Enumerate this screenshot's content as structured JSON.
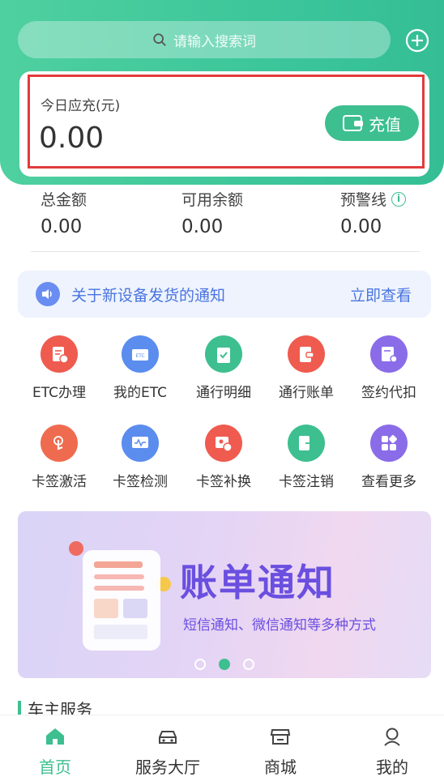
{
  "search": {
    "placeholder": "请输入搜索词"
  },
  "recharge_card": {
    "label": "今日应充(元)",
    "amount": "0.00",
    "button_label": "充值"
  },
  "stats": [
    {
      "label": "总金额",
      "value": "0.00"
    },
    {
      "label": "可用余额",
      "value": "0.00"
    },
    {
      "label": "预警线",
      "value": "0.00"
    }
  ],
  "notice": {
    "message": "关于新设备发货的通知",
    "action": "立即查看"
  },
  "services": [
    {
      "label": "ETC办理",
      "icon": "etc-apply-icon",
      "color": "#ef5b4f"
    },
    {
      "label": "我的ETC",
      "icon": "etc-card-icon",
      "color": "#5b8def"
    },
    {
      "label": "通行明细",
      "icon": "clipboard-check-icon",
      "color": "#3dbf8f"
    },
    {
      "label": "通行账单",
      "icon": "bill-icon",
      "color": "#ef5b4f"
    },
    {
      "label": "签约代扣",
      "icon": "contract-icon",
      "color": "#8a6ce8"
    },
    {
      "label": "卡签激活",
      "icon": "tap-activate-icon",
      "color": "#ef6b4f"
    },
    {
      "label": "卡签检测",
      "icon": "monitor-icon",
      "color": "#5b8def"
    },
    {
      "label": "卡签补换",
      "icon": "card-replace-icon",
      "color": "#ef5b4f"
    },
    {
      "label": "卡签注销",
      "icon": "logout-icon",
      "color": "#3dbf8f"
    },
    {
      "label": "查看更多",
      "icon": "apps-more-icon",
      "color": "#8a6ce8"
    }
  ],
  "banner": {
    "title": "账单通知",
    "subtitle": "短信通知、微信通知等多种方式",
    "active_index": 1,
    "count": 3
  },
  "section": {
    "title": "车主服务"
  },
  "tabs": [
    {
      "label": "首页",
      "icon": "home-icon",
      "active": true
    },
    {
      "label": "服务大厅",
      "icon": "car-icon",
      "active": false
    },
    {
      "label": "商城",
      "icon": "store-icon",
      "active": false
    },
    {
      "label": "我的",
      "icon": "user-icon",
      "active": false
    }
  ],
  "colors": {
    "accent": "#3dbf8f",
    "notice_blue": "#4a74e0",
    "highlight_red": "#e23b3b"
  }
}
